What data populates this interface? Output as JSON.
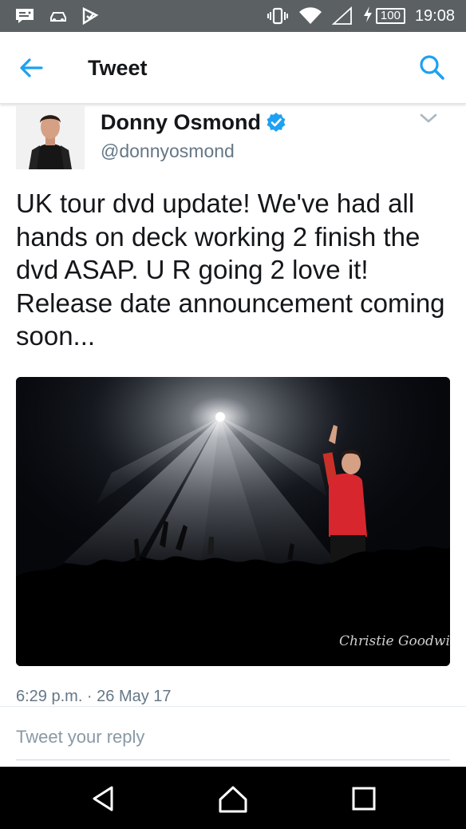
{
  "status_bar": {
    "battery": "100",
    "time": "19:08",
    "icons": [
      "notification-icon",
      "car-icon",
      "tasks-icon",
      "vibrate-icon",
      "wifi-icon",
      "signal-icon",
      "charging-icon",
      "battery-icon"
    ]
  },
  "app_bar": {
    "title": "Tweet",
    "icons": [
      "back-arrow-icon",
      "search-icon"
    ]
  },
  "tweet": {
    "author_name": "Donny Osmond",
    "author_handle": "@donnyosmond",
    "text": "UK tour dvd update! We've had all hands on deck working 2 finish the dvd ASAP. U R going 2 love it! Release date announcement coming soon...",
    "timestamp": "6:29 p.m. · 26 May 17",
    "media_watermark": "Christie Goodwin"
  },
  "reply": {
    "placeholder": "Tweet your reply"
  },
  "nav_bar": {
    "icons": [
      "back-triangle-icon",
      "home-icon",
      "recents-icon"
    ]
  },
  "colors": {
    "accent": "#1da1f2",
    "status_bar": "#5b6063",
    "verified": "#1da1f2",
    "shirt": "#d8262f"
  }
}
